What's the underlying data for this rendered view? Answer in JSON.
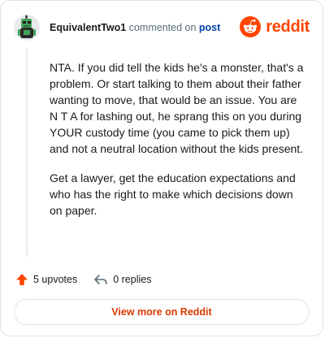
{
  "comment": {
    "author": "EquivalentTwo1",
    "verb": "commented on",
    "link_text": "post",
    "paragraphs": [
      "NTA. If you did tell the kids he's a monster, that's a problem. Or start talking to them about their father wanting to move, that would be an issue. You are N T A for lashing out, he sprang this on you during YOUR custody time (you came to pick them up) and not a neutral location without the kids present.",
      "Get a lawyer, get the education expectations and who has the right to make which decisions down on paper."
    ]
  },
  "brand": {
    "name": "reddit"
  },
  "stats": {
    "upvotes": "5 upvotes",
    "replies": "0 replies"
  },
  "cta": {
    "label": "View more on Reddit"
  },
  "colors": {
    "brand_orange": "#ff4500",
    "link_blue": "#0045ac",
    "cta_text": "#d93900",
    "avatar_bg": "#e8eaed"
  },
  "icons": {
    "avatar": "robot-avatar-icon",
    "brand": "reddit-snoo-icon",
    "upvote": "upvote-arrow-icon",
    "reply": "reply-arrow-icon"
  }
}
